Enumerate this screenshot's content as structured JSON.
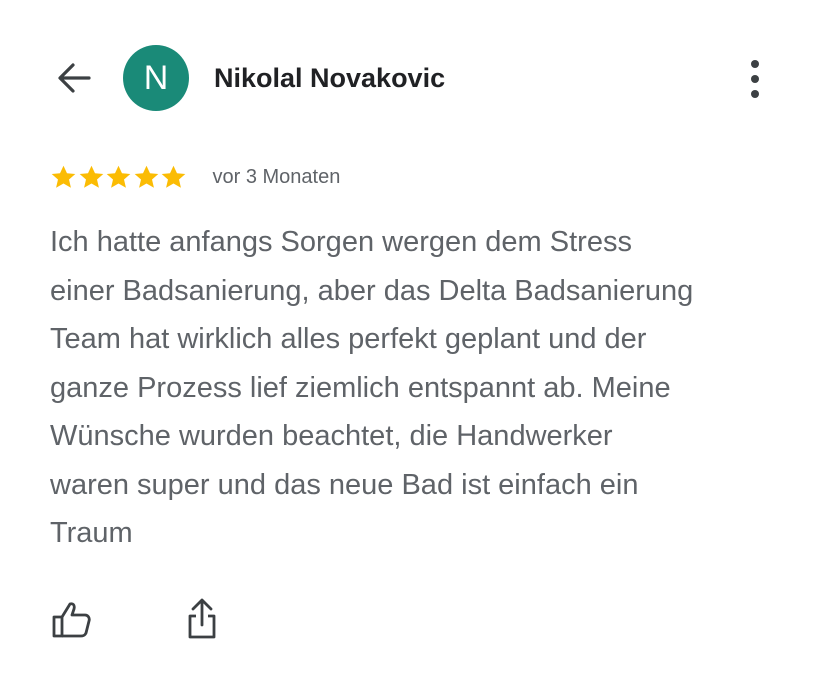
{
  "header": {
    "back_icon": "arrow-back-icon",
    "avatar_initial": "N",
    "avatar_color": "#1a8a78",
    "author_name": "Nikolal Novakovic",
    "more_icon": "more-vert-icon"
  },
  "review": {
    "rating": 5,
    "rating_max": 5,
    "star_color": "#fbbc04",
    "date": "vor 3 Monaten",
    "lines": [
      "Ich hatte anfangs Sorgen wergen dem Stress",
      "einer Badsanierung, aber das Delta Badsanierung",
      "Team hat wirklich alles perfekt geplant und der",
      "ganze Prozess lief ziemlich entspannt ab. Meine",
      "Wünsche wurden beachtet, die Handwerker",
      "waren super und das neue Bad ist einfach ein",
      "Traum"
    ]
  },
  "actions": {
    "like_icon": "thumb-up-icon",
    "share_icon": "share-icon"
  }
}
